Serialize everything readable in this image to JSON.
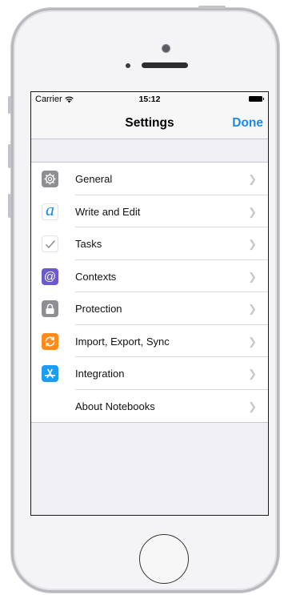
{
  "status": {
    "carrier": "Carrier",
    "time": "15:12"
  },
  "nav": {
    "title": "Settings",
    "done_label": "Done"
  },
  "settings": {
    "items": [
      {
        "label": "General",
        "icon": "gear-icon",
        "color": "#8e8e93"
      },
      {
        "label": "Write and Edit",
        "icon": "script-a-icon",
        "color": "#1d8ae8"
      },
      {
        "label": "Tasks",
        "icon": "checkmark-icon",
        "color": "#8e8e93"
      },
      {
        "label": "Contexts",
        "icon": "at-sign-icon",
        "color": "#6a5acd"
      },
      {
        "label": "Protection",
        "icon": "lock-icon",
        "color": "#8e8e93"
      },
      {
        "label": "Import, Export, Sync",
        "icon": "sync-icon",
        "color": "#ff8c1a"
      },
      {
        "label": "Integration",
        "icon": "app-store-icon",
        "color": "#1c9cf6"
      },
      {
        "label": "About Notebooks",
        "icon": "",
        "color": ""
      }
    ]
  },
  "colors": {
    "accent": "#1d8ae8",
    "background": "#efeff4"
  }
}
